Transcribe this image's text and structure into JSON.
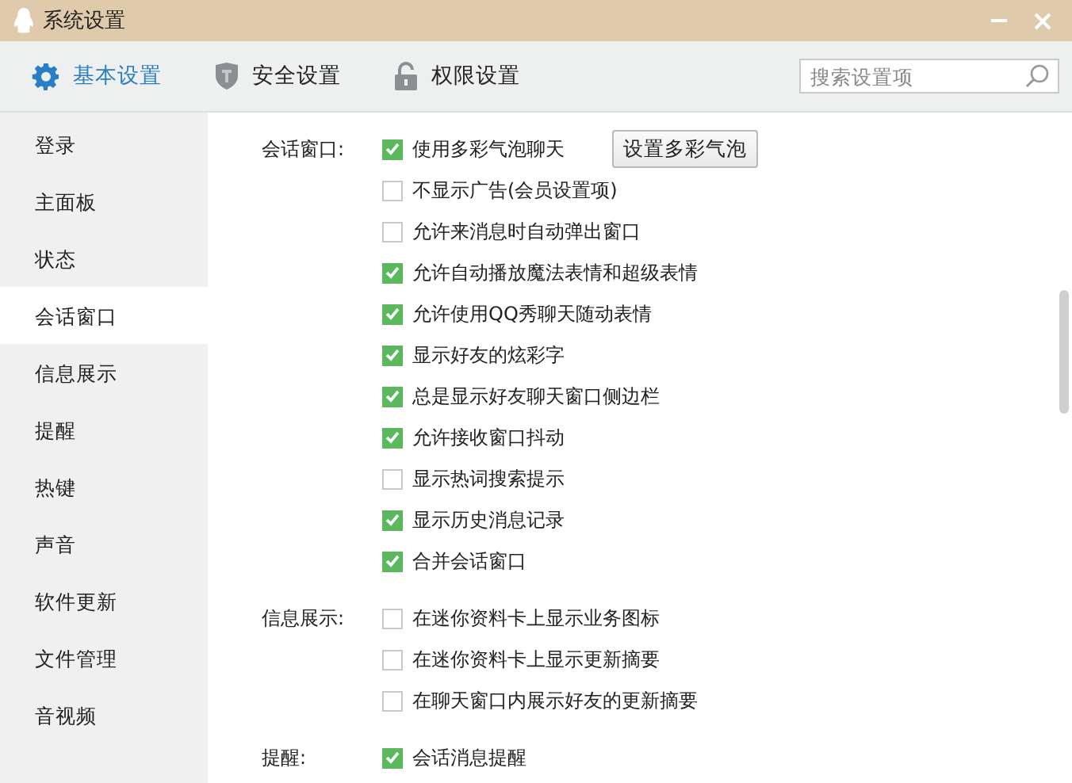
{
  "window": {
    "title": "系统设置"
  },
  "tabs": [
    {
      "label": "基本设置",
      "selected": true
    },
    {
      "label": "安全设置",
      "selected": false
    },
    {
      "label": "权限设置",
      "selected": false
    }
  ],
  "search": {
    "placeholder": "搜索设置项"
  },
  "sidebar": {
    "items": [
      {
        "label": "登录",
        "selected": false
      },
      {
        "label": "主面板",
        "selected": false
      },
      {
        "label": "状态",
        "selected": false
      },
      {
        "label": "会话窗口",
        "selected": true
      },
      {
        "label": "信息展示",
        "selected": false
      },
      {
        "label": "提醒",
        "selected": false
      },
      {
        "label": "热键",
        "selected": false
      },
      {
        "label": "声音",
        "selected": false
      },
      {
        "label": "软件更新",
        "selected": false
      },
      {
        "label": "文件管理",
        "selected": false
      },
      {
        "label": "音视频",
        "selected": false
      }
    ]
  },
  "sections": [
    {
      "label": "会话窗口:",
      "options": [
        {
          "label": "使用多彩气泡聊天",
          "checked": true,
          "button": "设置多彩气泡"
        },
        {
          "label": "不显示广告(会员设置项)",
          "checked": false
        },
        {
          "label": "允许来消息时自动弹出窗口",
          "checked": false
        },
        {
          "label": "允许自动播放魔法表情和超级表情",
          "checked": true
        },
        {
          "label": "允许使用QQ秀聊天随动表情",
          "checked": true
        },
        {
          "label": "显示好友的炫彩字",
          "checked": true
        },
        {
          "label": "总是显示好友聊天窗口侧边栏",
          "checked": true
        },
        {
          "label": "允许接收窗口抖动",
          "checked": true
        },
        {
          "label": "显示热词搜索提示",
          "checked": false
        },
        {
          "label": "显示历史消息记录",
          "checked": true
        },
        {
          "label": "合并会话窗口",
          "checked": true
        }
      ]
    },
    {
      "label": "信息展示:",
      "options": [
        {
          "label": "在迷你资料卡上显示业务图标",
          "checked": false
        },
        {
          "label": "在迷你资料卡上显示更新摘要",
          "checked": false
        },
        {
          "label": "在聊天窗口内展示好友的更新摘要",
          "checked": false
        }
      ]
    },
    {
      "label": "提醒:",
      "options": [
        {
          "label": "会话消息提醒",
          "checked": true
        }
      ]
    }
  ]
}
